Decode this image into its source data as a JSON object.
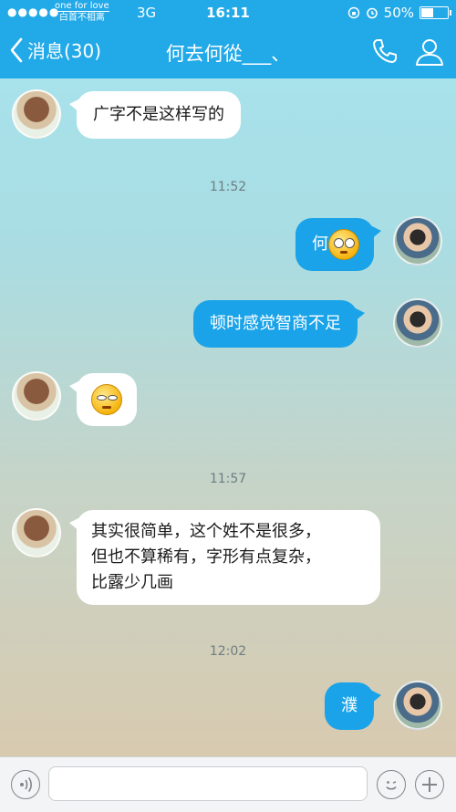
{
  "status_bar": {
    "signal": "●●●●●",
    "carrier_line1": "one for love",
    "carrier_line2": "白首不相离",
    "network": "3G",
    "time": "16:11",
    "battery_text": "50%",
    "battery_level": 0.5
  },
  "nav": {
    "back_label": "消息(30)",
    "title": "何去何從___、"
  },
  "messages": [
    {
      "side": "in",
      "text": "广字不是这样写的"
    },
    {
      "type": "time",
      "text": "11:52"
    },
    {
      "side": "out",
      "text": "何",
      "emoji": "dizzy-face-emoji"
    },
    {
      "side": "out",
      "text": "顿时感觉智商不足"
    },
    {
      "side": "in",
      "emoji": "smirk-face-emoji"
    },
    {
      "type": "time",
      "text": "11:57"
    },
    {
      "side": "in",
      "lines": [
        "其实很简单，这个姓不是很多，",
        "但也不算稀有，字形有点复杂，",
        "比露少几画"
      ]
    },
    {
      "type": "time",
      "text": "12:02"
    },
    {
      "side": "out",
      "text": "濮"
    }
  ],
  "icons": {
    "back": "chevron-left-icon",
    "phone": "phone-icon",
    "profile": "user-icon",
    "voice": "voice-icon",
    "emoji": "emoji-icon",
    "plus": "plus-icon"
  },
  "colors": {
    "accent": "#22a9e8",
    "outgoing_bubble": "#1aa3e8",
    "incoming_bubble": "#ffffff"
  }
}
